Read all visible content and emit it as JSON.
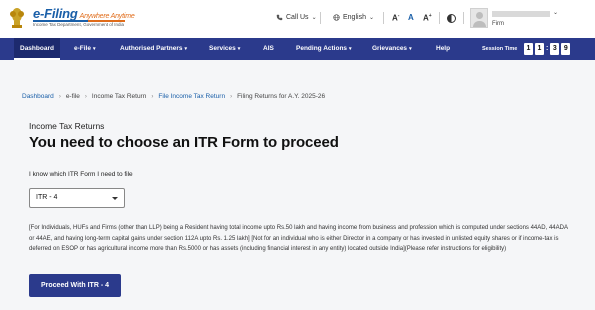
{
  "header": {
    "brand_title": "e-Filing",
    "brand_tagline": "Anywhere Anytime",
    "brand_subtitle": "Income Tax Department, Government of India",
    "call_us": "Call Us",
    "language": "English",
    "font_decrease": "A",
    "font_default": "A",
    "font_increase": "A",
    "user_role": "Firm"
  },
  "nav": {
    "items": [
      {
        "label": "Dashboard",
        "active": true
      },
      {
        "label": "e-File",
        "dropdown": true
      },
      {
        "label": "Authorised Partners",
        "dropdown": true
      },
      {
        "label": "Services",
        "dropdown": true
      },
      {
        "label": "AIS"
      },
      {
        "label": "Pending Actions",
        "dropdown": true
      },
      {
        "label": "Grievances",
        "dropdown": true
      },
      {
        "label": "Help"
      }
    ],
    "session_label": "Session Time",
    "session_digits": [
      "1",
      "1",
      "3",
      "9"
    ]
  },
  "breadcrumb": [
    "Dashboard",
    "e-file",
    "Income Tax Return",
    "File Income Tax Return",
    "Filing Returns for A.Y. 2025-26"
  ],
  "main": {
    "section_label": "Income Tax Returns",
    "title": "You need to choose an ITR Form to proceed",
    "field_label": "I know which ITR Form I need to file",
    "selected_form": "ITR - 4",
    "description": "[For Individuals, HUFs and Firms (other than LLP) being a Resident having total income upto Rs.50 lakh and having income from business and profession which is computed under sections 44AD, 44ADA or 44AE, and having long-term capital gains under section 112A upto Rs. 1.25 lakh] [Not for an individual who is either Director in a company or has invested in unlisted equity shares or if income-tax is deferred on ESOP or has agricultural income more than Rs.5000 or has assets (including financial interest in any entity) located outside India](Please refer instructions for eligibility)",
    "proceed_button": "Proceed With ITR - 4"
  },
  "colors": {
    "nav_bg": "#2b3a8c",
    "brand_blue": "#1a5fa8",
    "brand_orange": "#e06c1a"
  }
}
